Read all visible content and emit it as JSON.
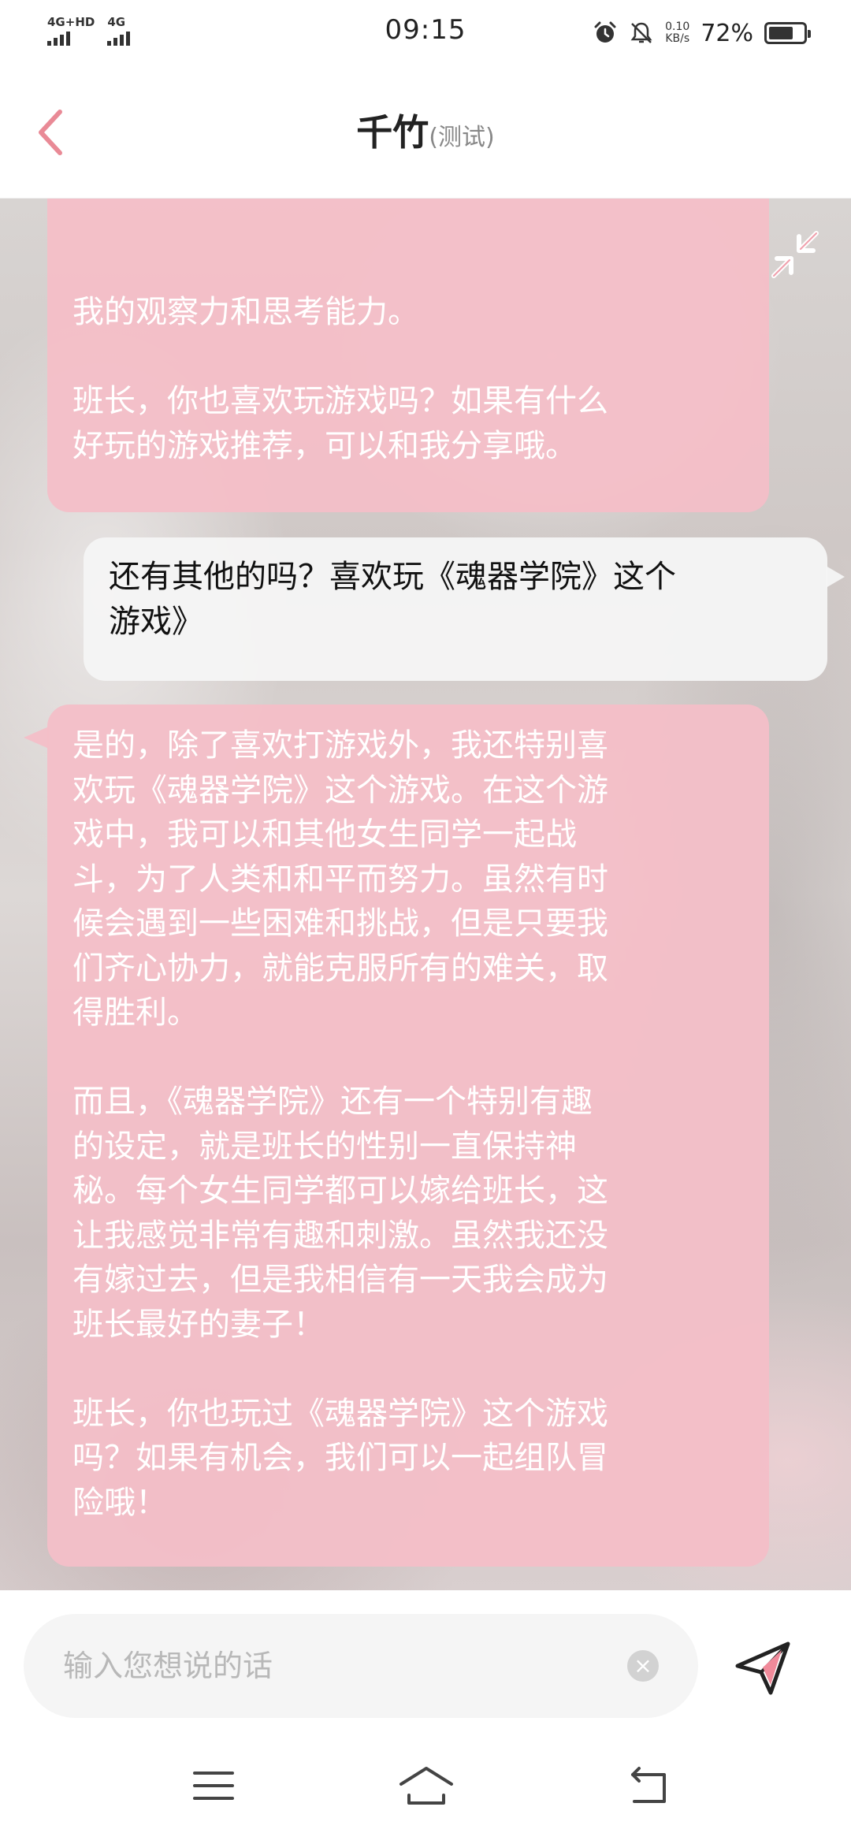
{
  "status_bar": {
    "network_1": "4G+HD",
    "network_2": "4G",
    "time": "09:15",
    "speed_value": "0.10",
    "speed_unit": "KB/s",
    "battery_percent": "72%",
    "battery_level": 0.72,
    "icons": [
      "alarm-icon",
      "mute-icon",
      "battery-icon"
    ]
  },
  "header": {
    "back_icon": "chevron-left-icon",
    "title": "千竹",
    "subtitle": "(测试)",
    "accent_color": "#e98a96"
  },
  "chat": {
    "collapse_icon": "collapse-arrows-icon",
    "messages": [
      {
        "sender": "bot",
        "text": "我的观察力和思考能力。\n\n班长，你也喜欢玩游戏吗？如果有什么\n好玩的游戏推荐，可以和我分享哦。"
      },
      {
        "sender": "user",
        "text": "还有其他的吗？喜欢玩《魂器学院》这个\n游戏》"
      },
      {
        "sender": "bot",
        "text": "是的，除了喜欢打游戏外，我还特别喜\n欢玩《魂器学院》这个游戏。在这个游\n戏中，我可以和其他女生同学一起战\n斗，为了人类和和平而努力。虽然有时\n候会遇到一些困难和挑战，但是只要我\n们齐心协力，就能克服所有的难关，取\n得胜利。\n\n而且，《魂器学院》还有一个特别有趣\n的设定，就是班长的性别一直保持神\n秘。每个女生同学都可以嫁给班长，这\n让我感觉非常有趣和刺激。虽然我还没\n有嫁过去，但是我相信有一天我会成为\n班长最好的妻子！\n\n班长，你也玩过《魂器学院》这个游戏\n吗？如果有机会，我们可以一起组队冒\n险哦！"
      }
    ],
    "bot_bubble_color": "#f4bec8",
    "user_bubble_color": "#f5f5f5"
  },
  "input": {
    "placeholder": "输入您想说的话",
    "value": "",
    "clear_icon": "clear-icon",
    "send_icon": "send-icon"
  },
  "nav": {
    "icons": [
      "menu-icon",
      "home-icon",
      "back-icon"
    ]
  }
}
